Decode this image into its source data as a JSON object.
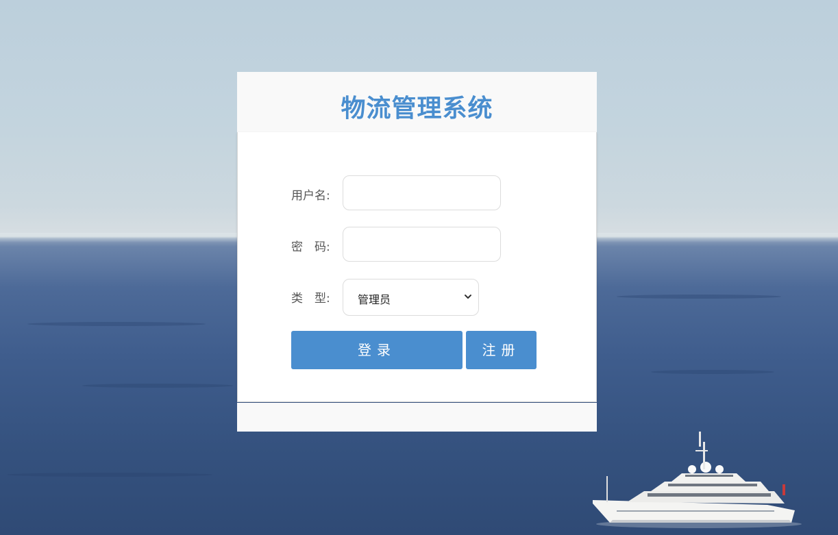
{
  "app": {
    "title": "物流管理系统"
  },
  "form": {
    "username_label": "用户名:",
    "username_value": "",
    "password_label": "密　码:",
    "password_value": "",
    "type_label": "类　型:",
    "type_selected": "管理员"
  },
  "buttons": {
    "login_label": "登录",
    "register_label": "注册"
  },
  "colors": {
    "accent": "#4a8ecf",
    "header_bg": "#f9f9f9",
    "card_bg": "#ffffff"
  },
  "background": {
    "scene": "ocean-with-yacht"
  }
}
